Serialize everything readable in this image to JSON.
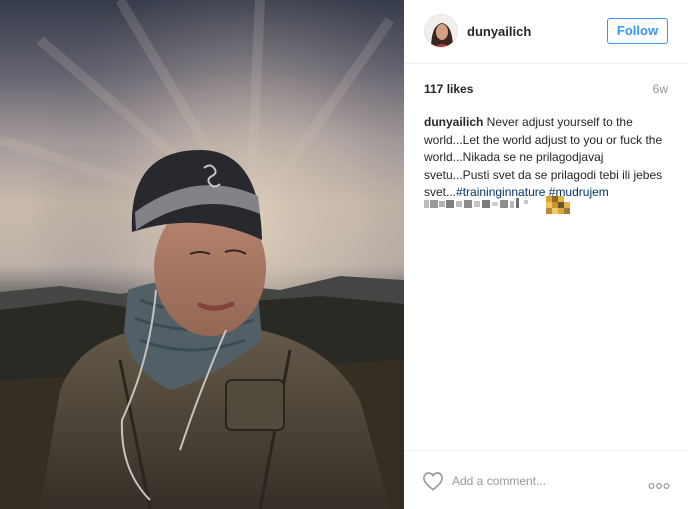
{
  "post": {
    "username": "dunyailich",
    "follow_label": "Follow",
    "likes": "117 likes",
    "time_ago": "6w",
    "caption": {
      "author": "dunyailich",
      "text": " Never adjust yourself to the world...Let the world adjust to you or fuck the world...Nikada se ne prilagodjavaj svetu...Pusti svet da se prilagodi tebi ili jebes svet...",
      "hashtags": [
        "#traininginnature",
        "#mudrujem"
      ]
    },
    "comment_placeholder": "Add a comment...",
    "icons": {
      "like": "heart-icon",
      "more": "ellipsis-icon"
    }
  },
  "colors": {
    "accent": "#3897f0",
    "hashtag": "#003569",
    "muted": "#999999",
    "text": "#262626"
  }
}
